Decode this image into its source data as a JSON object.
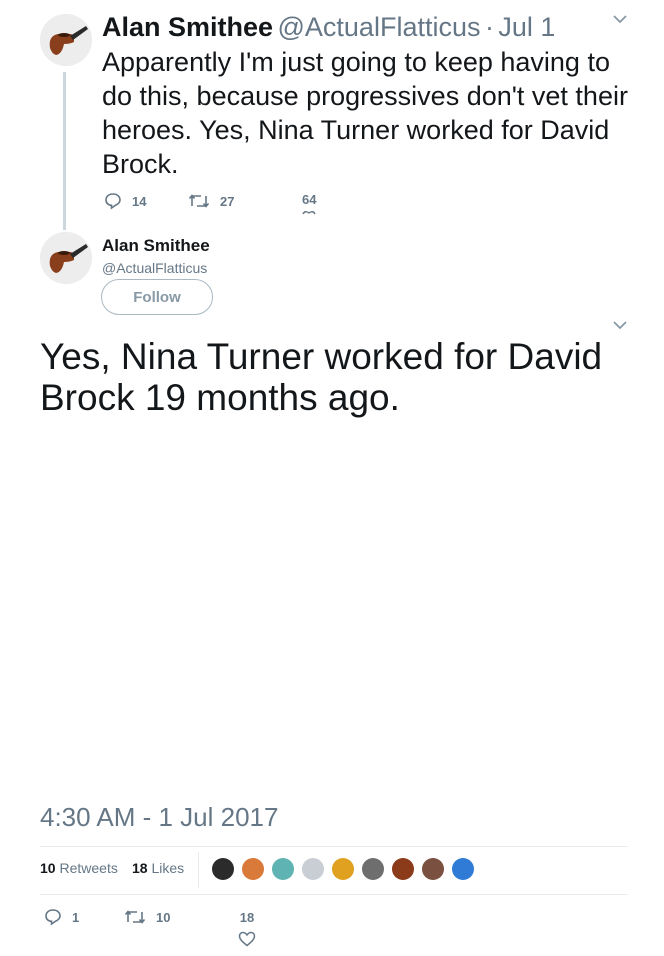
{
  "parent_tweet": {
    "name": "Alan Smithee",
    "handle": "@ActualFlatticus",
    "separator": "·",
    "date": "Jul 1",
    "text": "Apparently I'm just going to keep having to do this, because progressives don't vet their heroes.  Yes, Nina Turner worked for David Brock.",
    "replies": "14",
    "retweets": "27",
    "likes": "64"
  },
  "main_tweet": {
    "name": "Alan Smithee",
    "handle": "@ActualFlatticus",
    "follow_label": "Follow",
    "text": "Yes, Nina Turner worked for David Brock 19 months ago.",
    "timestamp": "4:30 AM - 1 Jul 2017",
    "retweet_count": "10",
    "retweet_label": "Retweets",
    "like_count": "18",
    "like_label": "Likes",
    "replies": "1",
    "retweets": "10",
    "likes": "18"
  },
  "likers": [
    {
      "icon": "liker-avatar-1",
      "color": "#2b2b2b"
    },
    {
      "icon": "liker-avatar-2",
      "color": "#d97a3a"
    },
    {
      "icon": "liker-avatar-3",
      "color": "#5fb3b3"
    },
    {
      "icon": "liker-avatar-4",
      "color": "#c8ced4"
    },
    {
      "icon": "liker-avatar-5",
      "color": "#e0a020"
    },
    {
      "icon": "liker-avatar-6",
      "color": "#6e6e6e"
    },
    {
      "icon": "liker-avatar-7",
      "color": "#8b3a1a"
    },
    {
      "icon": "liker-avatar-8",
      "color": "#7a5040"
    },
    {
      "icon": "liker-avatar-9",
      "color": "#2f7bd6"
    }
  ],
  "colors": {
    "text": "#14171a",
    "secondary": "#657786",
    "line": "#ccd6dd"
  }
}
